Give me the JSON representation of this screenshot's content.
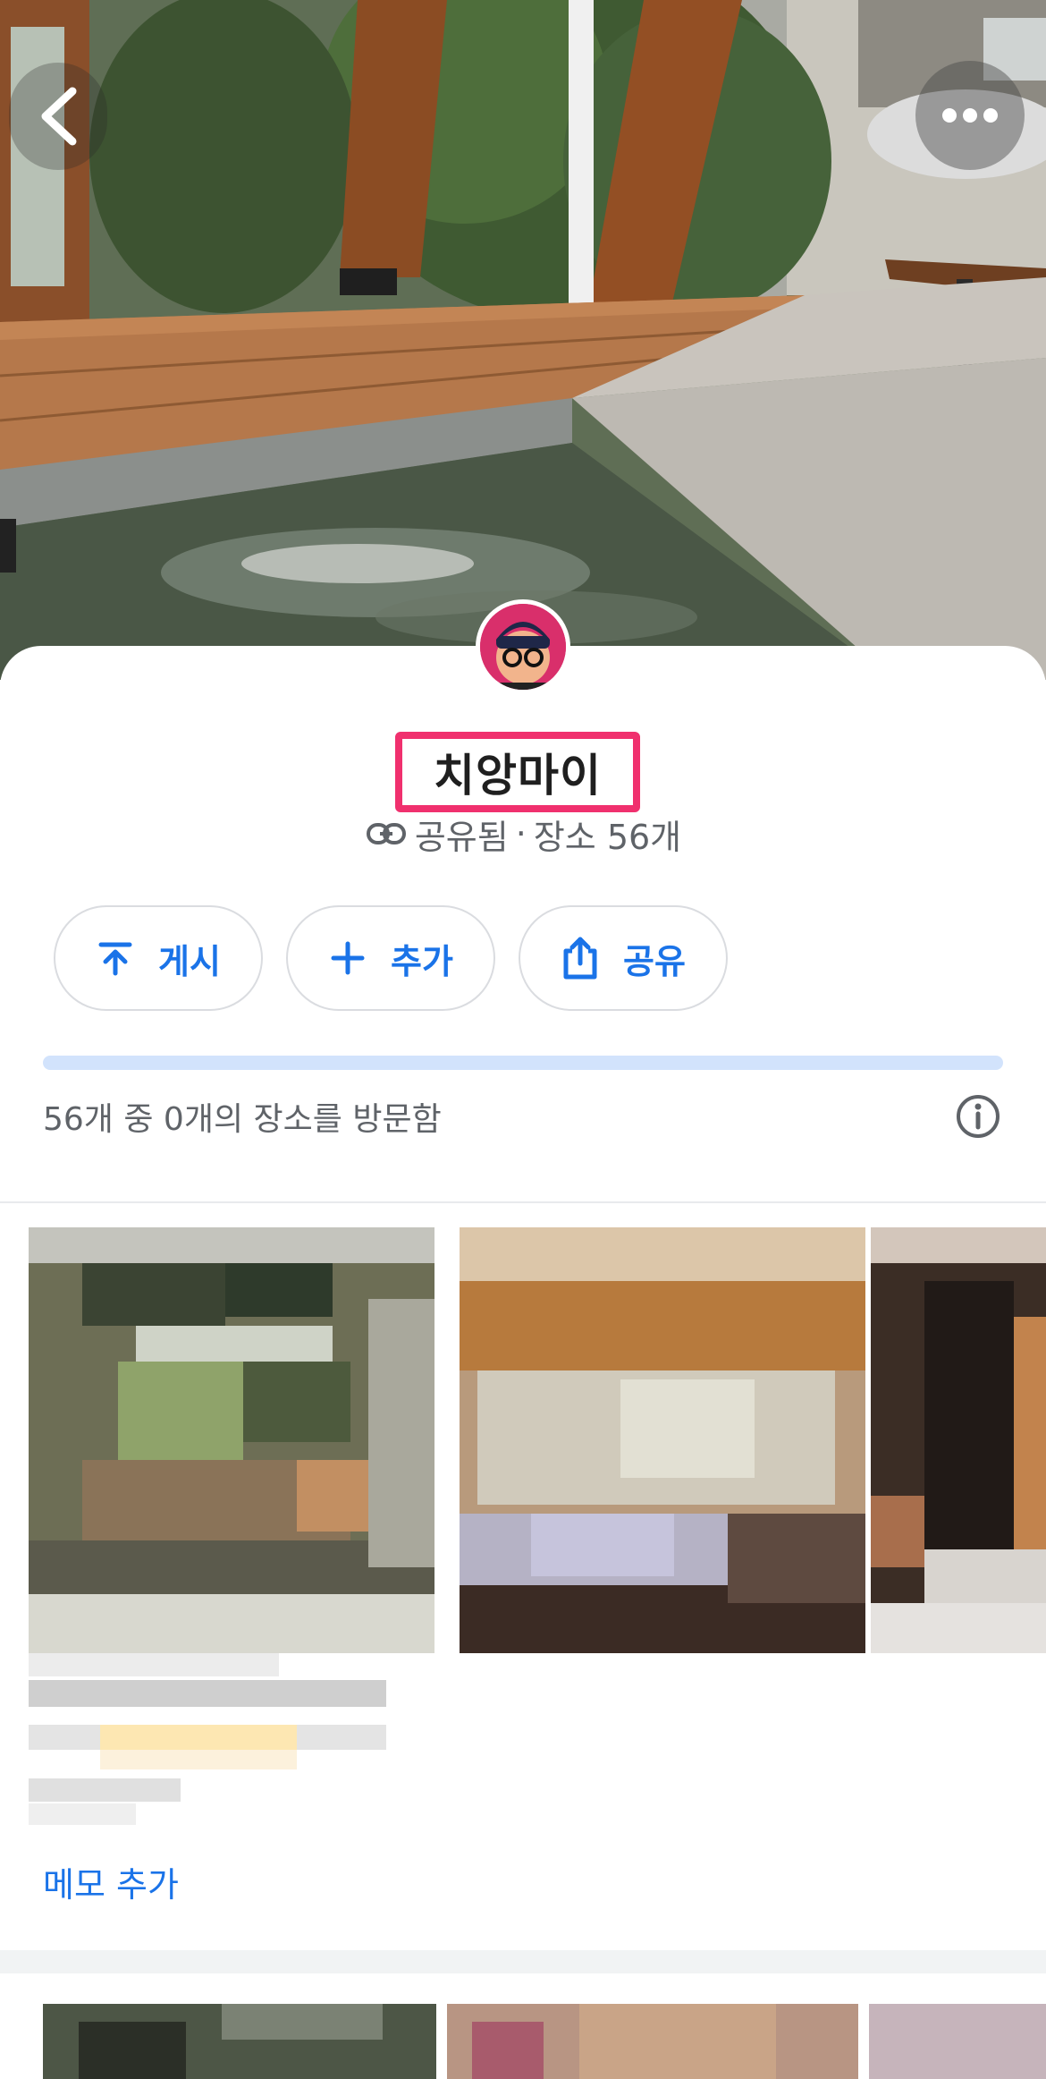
{
  "hero": {
    "back_icon": "chevron-left-icon",
    "more_icon": "more-horizontal-icon"
  },
  "list": {
    "title": "치앙마이",
    "shared_label": "공유됨",
    "separator": "·",
    "places_count": "장소 56개",
    "link_icon": "link-icon"
  },
  "actions": [
    {
      "label": "게시",
      "icon": "upload-icon"
    },
    {
      "label": "추가",
      "icon": "plus-icon"
    },
    {
      "label": "공유",
      "icon": "share-icon"
    }
  ],
  "progress": {
    "visited": 0,
    "total": 56,
    "fraction": 0,
    "label": "56개 중 0개의 장소를 방문함"
  },
  "place": {
    "memo_label": "메모 추가"
  },
  "colors": {
    "accent": "#1a73e8",
    "highlight": "#f0306e",
    "progress_track": "#d2e3fc"
  }
}
